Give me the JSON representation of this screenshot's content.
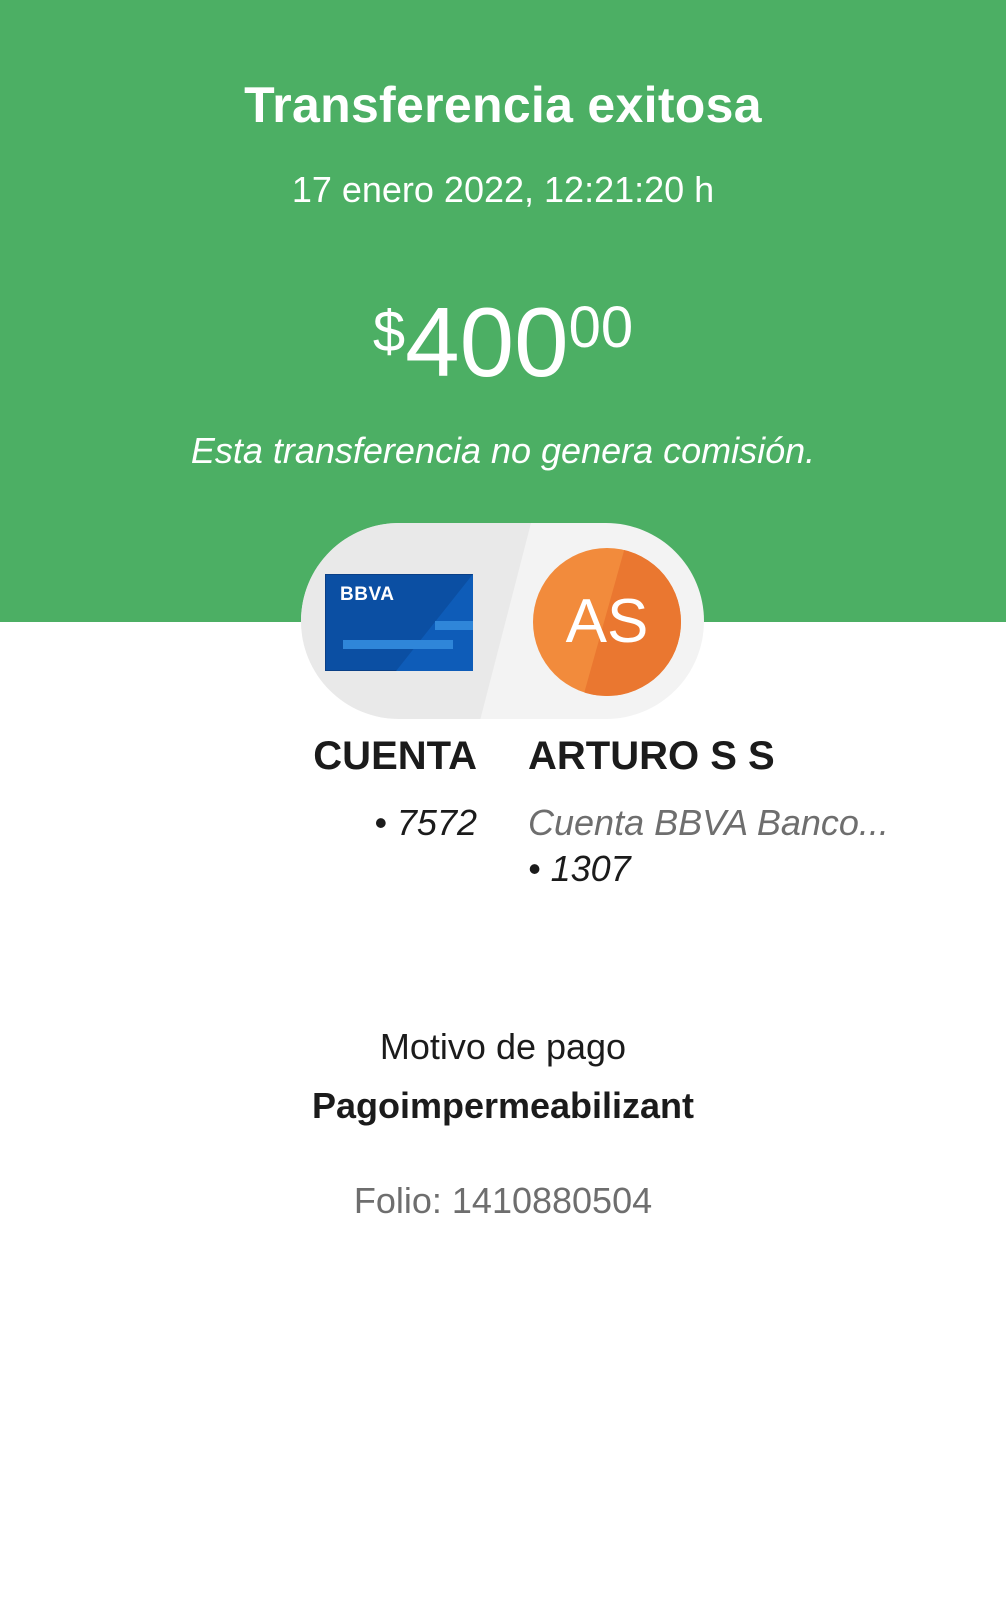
{
  "header": {
    "title": "Transferencia exitosa",
    "datetime": "17 enero 2022, 12:21:20 h",
    "amount": {
      "currency": "$",
      "integer": "400",
      "decimals": "00"
    },
    "commission_note": "Esta transferencia no genera comisión."
  },
  "from": {
    "card_logo": "BBVA",
    "name": "CUENTA",
    "account": "• 7572"
  },
  "to": {
    "initials": "AS",
    "name": "ARTURO S S",
    "bank": "Cuenta BBVA Banco...",
    "account": "• 1307"
  },
  "payment": {
    "reason_label": "Motivo de pago",
    "reason_value": "Pagoimpermeabilizant",
    "folio": "Folio: 1410880504"
  },
  "colors": {
    "header_green": "#4caf64",
    "card_blue": "#0b4fa3",
    "avatar_orange": "#f28b3c"
  }
}
